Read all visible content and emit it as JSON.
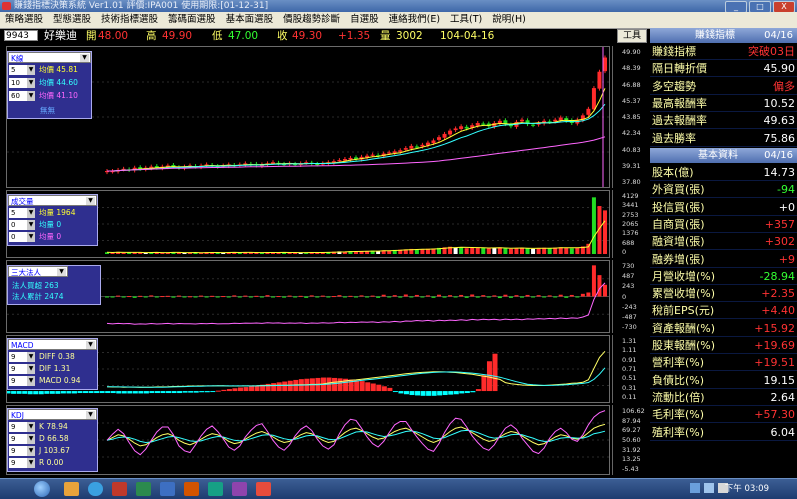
{
  "window": {
    "title": "賺錢指標決策系統 Ver1.01 評價:IPA001 使用期限:[01-12-31]",
    "minimize": "_",
    "maximize": "□",
    "close": "X"
  },
  "menu": [
    "策略選股",
    "型態選股",
    "技術指標選股",
    "籌碼面選股",
    "基本面選股",
    "價股趨勢診斷",
    "自選股",
    "連絡我們(E)",
    "工具(T)",
    "說明(H)"
  ],
  "quote": {
    "code": "9943",
    "name": "好樂迪",
    "open_label": "開",
    "open": "48.00",
    "high_label": "高",
    "high": "49.90",
    "low_label": "低",
    "low": "47.00",
    "close_label": "收",
    "close": "49.30",
    "change": "+1.35",
    "volume_label": "量",
    "volume": "3002",
    "date": "104-04-16"
  },
  "tools_button": "工具",
  "colors": {
    "up": "#ff2b2b",
    "down": "#22dd22",
    "neutral": "#ffffff",
    "label": "#ffff66",
    "cyan": "#00ffff",
    "panel_bg": "#000000"
  },
  "panels": {
    "kline": {
      "selector": "K線",
      "rows": [
        {
          "period": "5",
          "label": "均價",
          "value": "45.81",
          "color": "#ffff33"
        },
        {
          "period": "10",
          "label": "均價",
          "value": "44.60",
          "color": "#33ffff"
        },
        {
          "period": "60",
          "label": "均價",
          "value": "41.10",
          "color": "#ff66ff"
        }
      ],
      "extra": "無無",
      "axis": [
        "49.90",
        "48.39",
        "46.88",
        "45.37",
        "43.85",
        "42.34",
        "40.83",
        "39.31",
        "37.80"
      ]
    },
    "volume": {
      "selector": "成交量",
      "rows": [
        {
          "period": "5",
          "label": "均量",
          "value": "1964",
          "color": "#ffff33"
        },
        {
          "period": "0",
          "label": "均量",
          "value": "0",
          "color": "#33ffff"
        },
        {
          "period": "0",
          "label": "均量",
          "value": "0",
          "color": "#ff66ff"
        }
      ],
      "axis": [
        "4129",
        "3441",
        "2753",
        "2065",
        "1376",
        "688",
        "0"
      ]
    },
    "institutional": {
      "selector": "三大法人",
      "rows": [
        {
          "label": "法人買超",
          "value": "263",
          "color": "#33ffff"
        },
        {
          "label": "法人累計",
          "value": "2474",
          "color": "#33ffff"
        }
      ],
      "axis": [
        "730",
        "487",
        "243",
        "0",
        "-243",
        "-487",
        "-730"
      ]
    },
    "macd": {
      "selector": "MACD",
      "rows": [
        {
          "period": "9",
          "label": "DIFF",
          "value": "0.38",
          "color": "#ffff99"
        },
        {
          "period": "9",
          "label": "DIF",
          "value": "1.31",
          "color": "#ffff99"
        },
        {
          "period": "9",
          "label": "MACD",
          "value": "0.94",
          "color": "#ffff99"
        }
      ],
      "axis": [
        "1.31",
        "1.11",
        "0.91",
        "0.71",
        "0.51",
        "0.31",
        "0.11"
      ]
    },
    "kdj": {
      "selector": "KDJ",
      "rows": [
        {
          "period": "9",
          "label": "K",
          "value": "78.94",
          "color": "#ffff99"
        },
        {
          "period": "9",
          "label": "D",
          "value": "66.58",
          "color": "#ffff99"
        },
        {
          "period": "9",
          "label": "J",
          "value": "103.67",
          "color": "#ffff99"
        },
        {
          "period": "9",
          "label": "R",
          "value": "0.00",
          "color": "#ffff99"
        }
      ],
      "axis": [
        "106.62",
        "87.94",
        "69.27",
        "50.60",
        "31.92",
        "13.25",
        "-5.43"
      ]
    }
  },
  "indicator_panel": {
    "title": "賺錢指標",
    "date": "04/16",
    "rows": [
      {
        "k": "賺錢指標",
        "v": "突破03日",
        "color": "#ff3333"
      },
      {
        "k": "隔日轉折價",
        "v": "45.90",
        "color": "#ffffff"
      },
      {
        "k": "多空趨勢",
        "v": "偏多",
        "color": "#ff3333"
      },
      {
        "k": "最高報酬率",
        "v": "10.52",
        "color": "#ffffff"
      },
      {
        "k": "過去報酬率",
        "v": "49.63",
        "color": "#ffffff"
      },
      {
        "k": "過去勝率",
        "v": "75.86",
        "color": "#ffffff"
      }
    ]
  },
  "fundamental_panel": {
    "title": "基本資料",
    "date": "04/16",
    "rows": [
      {
        "k": "股本(億)",
        "v": "14.73",
        "color": "#ffffff"
      },
      {
        "k": "外資買(張)",
        "v": "-94",
        "color": "#33ff33"
      },
      {
        "k": "投信買(張)",
        "v": "+0",
        "color": "#ffffff"
      },
      {
        "k": "自商買(張)",
        "v": "+357",
        "color": "#ff3333"
      },
      {
        "k": "融資增(張)",
        "v": "+302",
        "color": "#ff3333"
      },
      {
        "k": "融券增(張)",
        "v": "+9",
        "color": "#ff3333"
      },
      {
        "k": "月營收增(%)",
        "v": "-28.94",
        "color": "#33ff33"
      },
      {
        "k": "累營收增(%)",
        "v": "+2.35",
        "color": "#ff3333"
      },
      {
        "k": "稅前EPS(元)",
        "v": "+4.40",
        "color": "#ff3333"
      },
      {
        "k": "資產報酬(%)",
        "v": "+15.92",
        "color": "#ff3333"
      },
      {
        "k": "股東報酬(%)",
        "v": "+19.69",
        "color": "#ff3333"
      },
      {
        "k": "營利率(%)",
        "v": "+19.51",
        "color": "#ff3333"
      },
      {
        "k": "負債比(%)",
        "v": "19.15",
        "color": "#ffffff"
      },
      {
        "k": "流動比(倍)",
        "v": "2.64",
        "color": "#ffffff"
      },
      {
        "k": "毛利率(%)",
        "v": "+57.30",
        "color": "#ff3333"
      },
      {
        "k": "殖利率(%)",
        "v": "6.04",
        "color": "#ffffff"
      }
    ]
  },
  "taskbar": {
    "clock": "下午 03:09"
  },
  "chart_data": [
    {
      "type": "candlestick",
      "title": "",
      "ylim": [
        37.8,
        49.9
      ],
      "close": [
        38.9,
        38.9,
        39.0,
        39.1,
        39.0,
        39.2,
        39.1,
        39.2,
        39.3,
        39.2,
        39.3,
        39.4,
        39.3,
        39.2,
        39.3,
        39.4,
        39.3,
        39.4,
        39.5,
        39.4,
        39.3,
        39.4,
        39.5,
        39.4,
        39.5,
        39.6,
        39.5,
        39.4,
        39.5,
        39.6,
        39.7,
        39.6,
        39.5,
        39.6,
        39.5,
        39.6,
        39.7,
        39.6,
        39.5,
        39.6,
        39.7,
        39.8,
        39.9,
        40.0,
        40.1,
        40.0,
        40.2,
        40.3,
        40.4,
        40.3,
        40.5,
        40.6,
        40.7,
        40.8,
        41.0,
        41.2,
        41.1,
        41.3,
        41.5,
        41.7,
        42.0,
        42.3,
        42.6,
        42.8,
        43.0,
        42.8,
        43.1,
        43.3,
        43.2,
        43.0,
        43.3,
        43.5,
        43.2,
        43.0,
        43.4,
        43.6,
        43.2,
        43.1,
        43.3,
        43.5,
        43.4,
        43.6,
        43.8,
        43.5,
        43.3,
        43.6,
        44.0,
        44.6,
        46.5,
        48.0,
        49.3
      ]
    },
    {
      "type": "bar",
      "title": "",
      "ylim": [
        0,
        4129
      ],
      "values": [
        120,
        90,
        150,
        80,
        100,
        130,
        90,
        70,
        110,
        140,
        80,
        95,
        120,
        100,
        85,
        90,
        110,
        75,
        130,
        95,
        100,
        80,
        120,
        140,
        90,
        110,
        100,
        85,
        95,
        120,
        130,
        100,
        90,
        80,
        110,
        95,
        100,
        120,
        90,
        105,
        140,
        160,
        180,
        150,
        200,
        170,
        190,
        210,
        230,
        200,
        260,
        240,
        280,
        300,
        320,
        350,
        300,
        330,
        360,
        380,
        420,
        460,
        500,
        440,
        480,
        400,
        430,
        450,
        410,
        380,
        420,
        460,
        390,
        360,
        410,
        440,
        380,
        350,
        400,
        430,
        410,
        440,
        470,
        420,
        390,
        430,
        520,
        700,
        3900,
        3300,
        3002
      ]
    },
    {
      "type": "bar",
      "title": "",
      "ylim": [
        -730,
        730
      ],
      "values": [
        -10,
        -20,
        20,
        -15,
        10,
        -30,
        15,
        -10,
        25,
        -20,
        10,
        15,
        -25,
        20,
        -10,
        5,
        -15,
        20,
        -10,
        15,
        -20,
        10,
        -5,
        25,
        -15,
        20,
        -10,
        15,
        -20,
        30,
        -15,
        10,
        -25,
        20,
        -10,
        15,
        -30,
        25,
        -10,
        20,
        -15,
        10,
        30,
        -20,
        15,
        -10,
        25,
        -15,
        20,
        -30,
        40,
        -20,
        30,
        -25,
        45,
        -15,
        35,
        -20,
        25,
        -30,
        40,
        -25,
        30,
        -20,
        35,
        -30,
        45,
        -25,
        30,
        -20,
        25,
        -35,
        40,
        -30,
        30,
        -25,
        35,
        -20,
        30,
        -15,
        25,
        -20,
        40,
        -30,
        35,
        -20,
        60,
        90,
        700,
        480,
        263
      ]
    },
    {
      "type": "bar",
      "title": "",
      "ylim": [
        -0.2,
        1.31
      ],
      "values": [
        -0.05,
        -0.06,
        -0.06,
        -0.07,
        -0.07,
        -0.07,
        -0.08,
        -0.08,
        -0.08,
        -0.07,
        -0.07,
        -0.07,
        -0.06,
        -0.06,
        -0.06,
        -0.05,
        -0.05,
        -0.05,
        -0.05,
        -0.05,
        -0.05,
        -0.05,
        -0.06,
        -0.06,
        -0.06,
        -0.06,
        -0.06,
        -0.06,
        -0.05,
        -0.05,
        -0.05,
        -0.05,
        -0.05,
        -0.05,
        -0.04,
        -0.04,
        -0.04,
        -0.03,
        -0.03,
        -0.02,
        0.01,
        0.03,
        0.05,
        0.07,
        0.09,
        0.1,
        0.12,
        0.14,
        0.16,
        0.18,
        0.2,
        0.22,
        0.24,
        0.26,
        0.28,
        0.3,
        0.31,
        0.32,
        0.33,
        0.34,
        0.34,
        0.33,
        0.32,
        0.31,
        0.29,
        0.27,
        0.25,
        0.22,
        0.19,
        0.16,
        0.12,
        0.08,
        -0.02,
        -0.06,
        -0.08,
        -0.1,
        -0.11,
        -0.12,
        -0.12,
        -0.12,
        -0.11,
        -0.1,
        -0.09,
        -0.08,
        -0.06,
        -0.05,
        -0.03,
        0.05,
        0.4,
        0.75,
        0.94
      ]
    },
    {
      "type": "line",
      "title": "",
      "ylim": [
        -5.43,
        106.62
      ],
      "series": [
        {
          "name": "K",
          "values": [
            50,
            55,
            60,
            58,
            52,
            45,
            40,
            42,
            48,
            55,
            60,
            62,
            58,
            50,
            45,
            42,
            46,
            52,
            58,
            62,
            60,
            55,
            48,
            44,
            46,
            52,
            58,
            63,
            66,
            62,
            56,
            50,
            46,
            48,
            54,
            60,
            64,
            62,
            56,
            50,
            46,
            48,
            56,
            64,
            70,
            72,
            68,
            62,
            56,
            52,
            54,
            60,
            66,
            70,
            72,
            68,
            62,
            56,
            50,
            46,
            50,
            58,
            66,
            72,
            74,
            70,
            64,
            58,
            52,
            48,
            50,
            56,
            62,
            66,
            64,
            58,
            52,
            46,
            42,
            44,
            50,
            56,
            60,
            58,
            54,
            52,
            56,
            64,
            72,
            76,
            78.94
          ]
        },
        {
          "name": "D",
          "values": [
            50,
            52,
            55,
            56,
            55,
            52,
            48,
            46,
            47,
            50,
            53,
            56,
            57,
            55,
            52,
            49,
            48,
            49,
            52,
            55,
            57,
            56,
            53,
            50,
            49,
            50,
            53,
            56,
            59,
            60,
            59,
            56,
            53,
            51,
            52,
            55,
            58,
            59,
            58,
            55,
            52,
            51,
            53,
            57,
            61,
            65,
            66,
            65,
            62,
            59,
            57,
            58,
            60,
            63,
            66,
            67,
            65,
            62,
            58,
            54,
            53,
            55,
            59,
            63,
            67,
            68,
            67,
            64,
            60,
            56,
            54,
            55,
            57,
            60,
            61,
            60,
            57,
            54,
            50,
            48,
            48,
            51,
            54,
            55,
            55,
            54,
            54,
            57,
            62,
            64,
            66.58
          ]
        },
        {
          "name": "J",
          "values": [
            50,
            61,
            70,
            62,
            46,
            31,
            24,
            34,
            50,
            65,
            74,
            74,
            60,
            40,
            31,
            28,
            42,
            58,
            70,
            76,
            66,
            53,
            38,
            32,
            40,
            56,
            68,
            77,
            80,
            66,
            50,
            38,
            32,
            42,
            58,
            70,
            76,
            68,
            52,
            40,
            34,
            42,
            62,
            78,
            88,
            86,
            72,
            56,
            44,
            38,
            48,
            64,
            78,
            84,
            84,
            70,
            56,
            44,
            34,
            30,
            44,
            64,
            80,
            90,
            88,
            74,
            58,
            46,
            36,
            32,
            42,
            58,
            72,
            78,
            70,
            54,
            42,
            30,
            26,
            36,
            54,
            66,
            72,
            64,
            52,
            48,
            60,
            78,
            92,
            100,
            103.67
          ]
        }
      ]
    }
  ]
}
